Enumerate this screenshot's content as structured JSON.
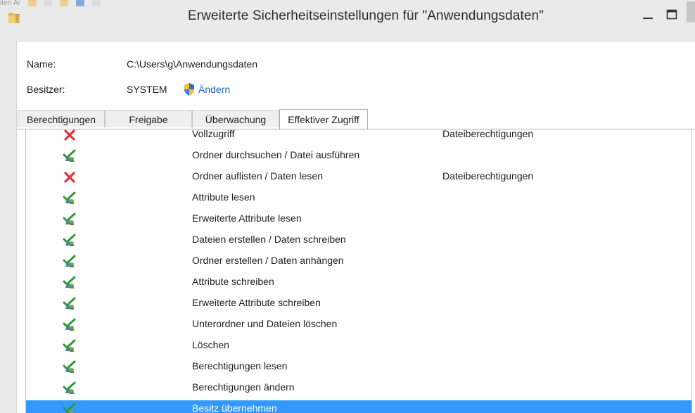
{
  "window": {
    "title": "Erweiterte Sicherheitseinstellungen für \"Anwendungsdaten\"",
    "background_strip": "iten  Är"
  },
  "info": {
    "name_label": "Name:",
    "name_value": "C:\\Users\\g\\Anwendungsdaten",
    "owner_label": "Besitzer:",
    "owner_value": "SYSTEM",
    "change_link": "Ändern"
  },
  "tabs": [
    {
      "label": "Berechtigungen",
      "active": false
    },
    {
      "label": "Freigabe",
      "active": false
    },
    {
      "label": "Überwachung",
      "active": false
    },
    {
      "label": "Effektiver Zugriff",
      "active": true
    }
  ],
  "permissions": [
    {
      "name": "Vollzugriff",
      "status": "deny-icon",
      "limited_by": "Dateiberechtigungen"
    },
    {
      "name": "Ordner durchsuchen / Datei ausführen",
      "status": "allow-icon",
      "limited_by": ""
    },
    {
      "name": "Ordner auflisten / Daten lesen",
      "status": "deny-icon",
      "limited_by": "Dateiberechtigungen"
    },
    {
      "name": "Attribute lesen",
      "status": "allow-icon",
      "limited_by": ""
    },
    {
      "name": "Erweiterte Attribute lesen",
      "status": "allow-icon",
      "limited_by": ""
    },
    {
      "name": "Dateien erstellen / Daten schreiben",
      "status": "allow-icon",
      "limited_by": ""
    },
    {
      "name": "Ordner erstellen / Daten anhängen",
      "status": "allow-icon",
      "limited_by": ""
    },
    {
      "name": "Attribute schreiben",
      "status": "allow-icon",
      "limited_by": ""
    },
    {
      "name": "Erweiterte Attribute schreiben",
      "status": "allow-icon",
      "limited_by": ""
    },
    {
      "name": "Unterordner und Dateien löschen",
      "status": "allow-icon",
      "limited_by": ""
    },
    {
      "name": "Löschen",
      "status": "allow-icon",
      "limited_by": ""
    },
    {
      "name": "Berechtigungen lesen",
      "status": "allow-icon",
      "limited_by": ""
    },
    {
      "name": "Berechtigungen ändern",
      "status": "allow-icon",
      "limited_by": ""
    },
    {
      "name": "Besitz übernehmen",
      "status": "allow-icon",
      "limited_by": "",
      "selected": true
    }
  ],
  "colors": {
    "selection": "#3399ff",
    "link": "#1e63b4",
    "deny": "#d9363e",
    "allow": "#2e9a3a"
  }
}
